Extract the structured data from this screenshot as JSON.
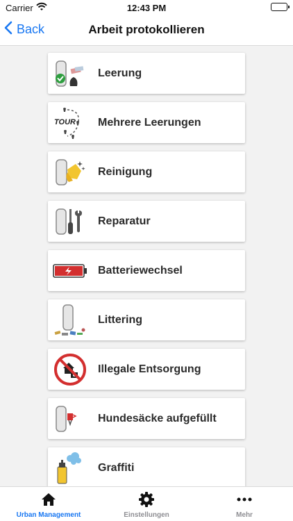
{
  "status_bar": {
    "carrier": "Carrier",
    "time": "12:43 PM"
  },
  "nav": {
    "back_label": "Back",
    "title": "Arbeit protokollieren"
  },
  "items": [
    {
      "label": "Leerung",
      "icon": "bin-emptied-check-icon"
    },
    {
      "label": "Mehrere Leerungen",
      "icon": "tour-route-icon"
    },
    {
      "label": "Reinigung",
      "icon": "bin-cleaning-icon"
    },
    {
      "label": "Reparatur",
      "icon": "bin-repair-tools-icon"
    },
    {
      "label": "Batteriewechsel",
      "icon": "battery-low-icon"
    },
    {
      "label": "Littering",
      "icon": "litter-icon"
    },
    {
      "label": "Illegale Entsorgung",
      "icon": "illegal-dumping-forbidden-icon"
    },
    {
      "label": "Hundesäcke aufgefüllt",
      "icon": "dog-bag-dispenser-icon"
    },
    {
      "label": "Graffiti",
      "icon": "spray-can-icon"
    }
  ],
  "tabs": [
    {
      "label": "Urban Management",
      "icon": "home-icon",
      "active": true
    },
    {
      "label": "Einstellungen",
      "icon": "gear-icon",
      "active": false
    },
    {
      "label": "Mehr",
      "icon": "more-dots-icon",
      "active": false
    }
  ],
  "colors": {
    "accent": "#1877f2",
    "danger": "#d32f2f",
    "check": "#2e9e3f"
  }
}
